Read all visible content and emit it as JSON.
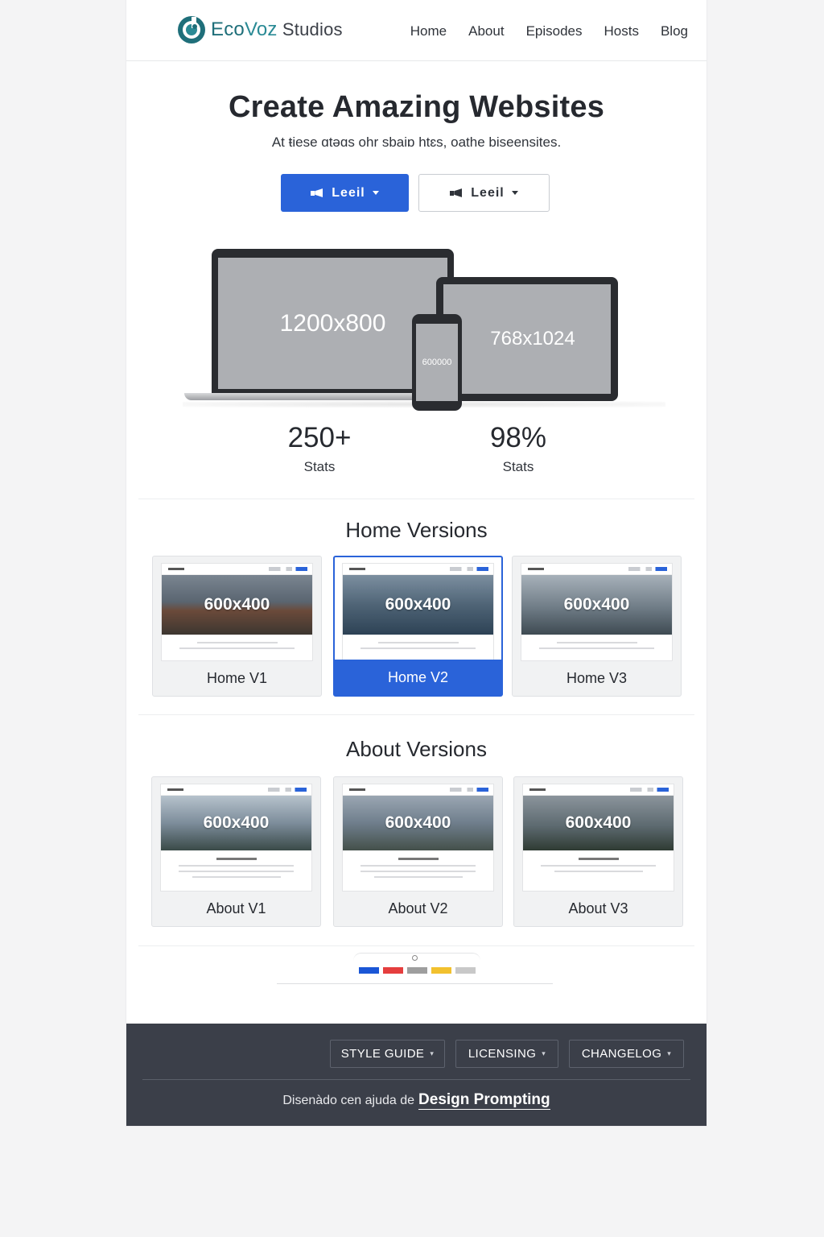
{
  "header": {
    "logo": {
      "eco": "Eco",
      "voz": "Voz",
      "studios": " Studios"
    },
    "nav": [
      "Home",
      "About",
      "Episodes",
      "Hosts",
      "Blog"
    ]
  },
  "hero": {
    "title": "Create Amazing Websites",
    "subtitle": "At ŧiese ɑtəɑs ohr sbaiɒ htɛs,  oathe biseensites.",
    "primary_button": "Leeil",
    "secondary_button": "Leeil",
    "devices": {
      "laptop": "1200x800",
      "tablet": "768x1024",
      "phone": "600000"
    }
  },
  "stats": [
    {
      "value": "250+",
      "label": "Stats"
    },
    {
      "value": "98%",
      "label": "Stats"
    }
  ],
  "home_versions": {
    "title": "Home Versions",
    "items": [
      {
        "label": "Home V1",
        "image": "600x400"
      },
      {
        "label": "Home V2",
        "image": "600x400",
        "active": true
      },
      {
        "label": "Home V3",
        "image": "600x400"
      }
    ]
  },
  "about_versions": {
    "title": "About Versions",
    "items": [
      {
        "label": "About V1",
        "image": "600x400"
      },
      {
        "label": "About V2",
        "image": "600x400"
      },
      {
        "label": "About V3",
        "image": "600x400"
      }
    ]
  },
  "palette": [
    "#1a56d6",
    "#e53e3e",
    "#9e9e9e",
    "#f2c12e",
    "#c8c8c8"
  ],
  "footer": {
    "buttons": [
      "STYLE GUIDE",
      "LICENSING",
      "CHANGELOG"
    ],
    "credit_text": "Disenàdo cen ajuda de",
    "credit_link": "Design Prompting"
  },
  "colors": {
    "accent": "#2a63d9",
    "footer_bg": "#3b3f49",
    "logo": "#1f6f7a"
  }
}
